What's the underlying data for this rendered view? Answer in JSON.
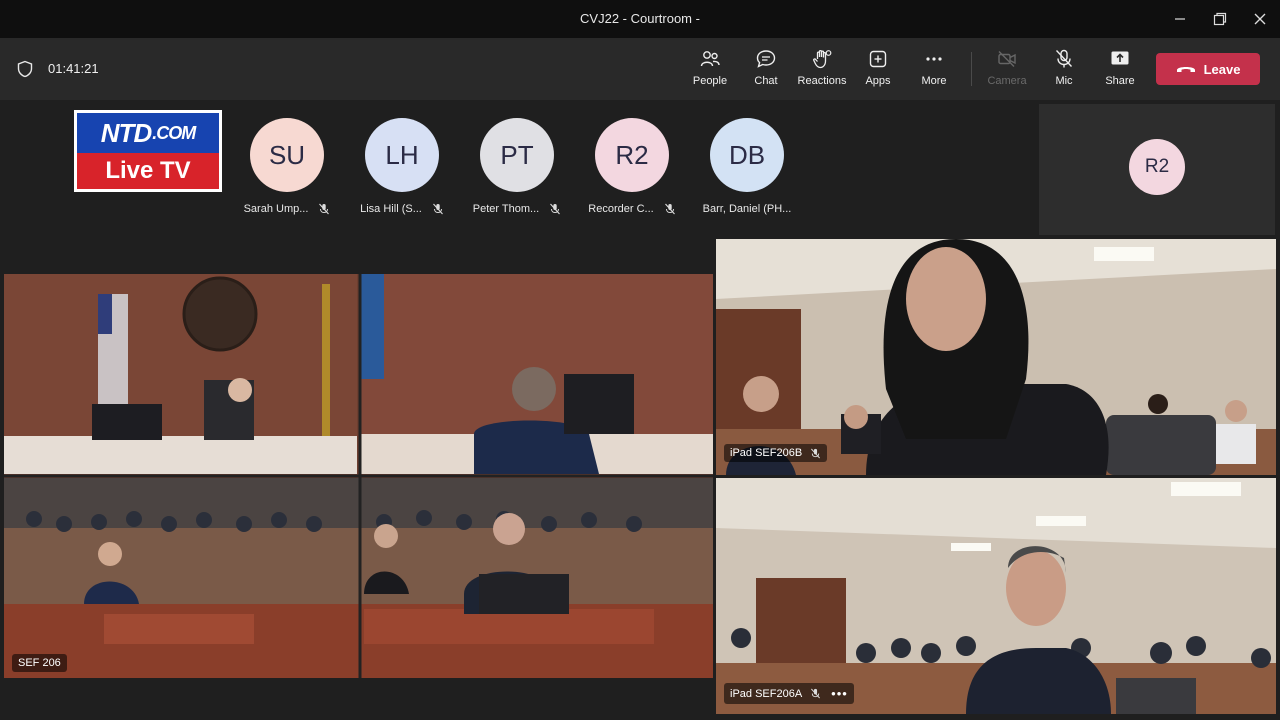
{
  "window": {
    "title": "CVJ22 - Courtroom -"
  },
  "toolbar": {
    "timer": "01:41:21",
    "buttons": {
      "people": "People",
      "chat": "Chat",
      "reactions": "Reactions",
      "apps": "Apps",
      "more": "More",
      "camera": "Camera",
      "mic": "Mic",
      "share": "Share"
    },
    "leave": "Leave",
    "leave_color": "#c4314b"
  },
  "logo": {
    "brand": "NTD",
    "suffix": ".COM",
    "tagline": "Live TV"
  },
  "participants": [
    {
      "initials": "SU",
      "name": "Sarah Ump...",
      "color": "#f7d9d2"
    },
    {
      "initials": "LH",
      "name": "Lisa Hill (S...",
      "color": "#d7e0f4"
    },
    {
      "initials": "PT",
      "name": "Peter Thom...",
      "color": "#e0e0e4"
    },
    {
      "initials": "R2",
      "name": "Recorder C...",
      "color": "#f3d7e0"
    },
    {
      "initials": "DB",
      "name": "Barr, Daniel (PH...",
      "color": "#d3e2f4"
    }
  ],
  "self_view": {
    "initials": "R2"
  },
  "tiles": [
    {
      "name": "SEF 206"
    },
    {
      "name": "iPad SEF206B"
    },
    {
      "name": "iPad SEF206A"
    }
  ]
}
